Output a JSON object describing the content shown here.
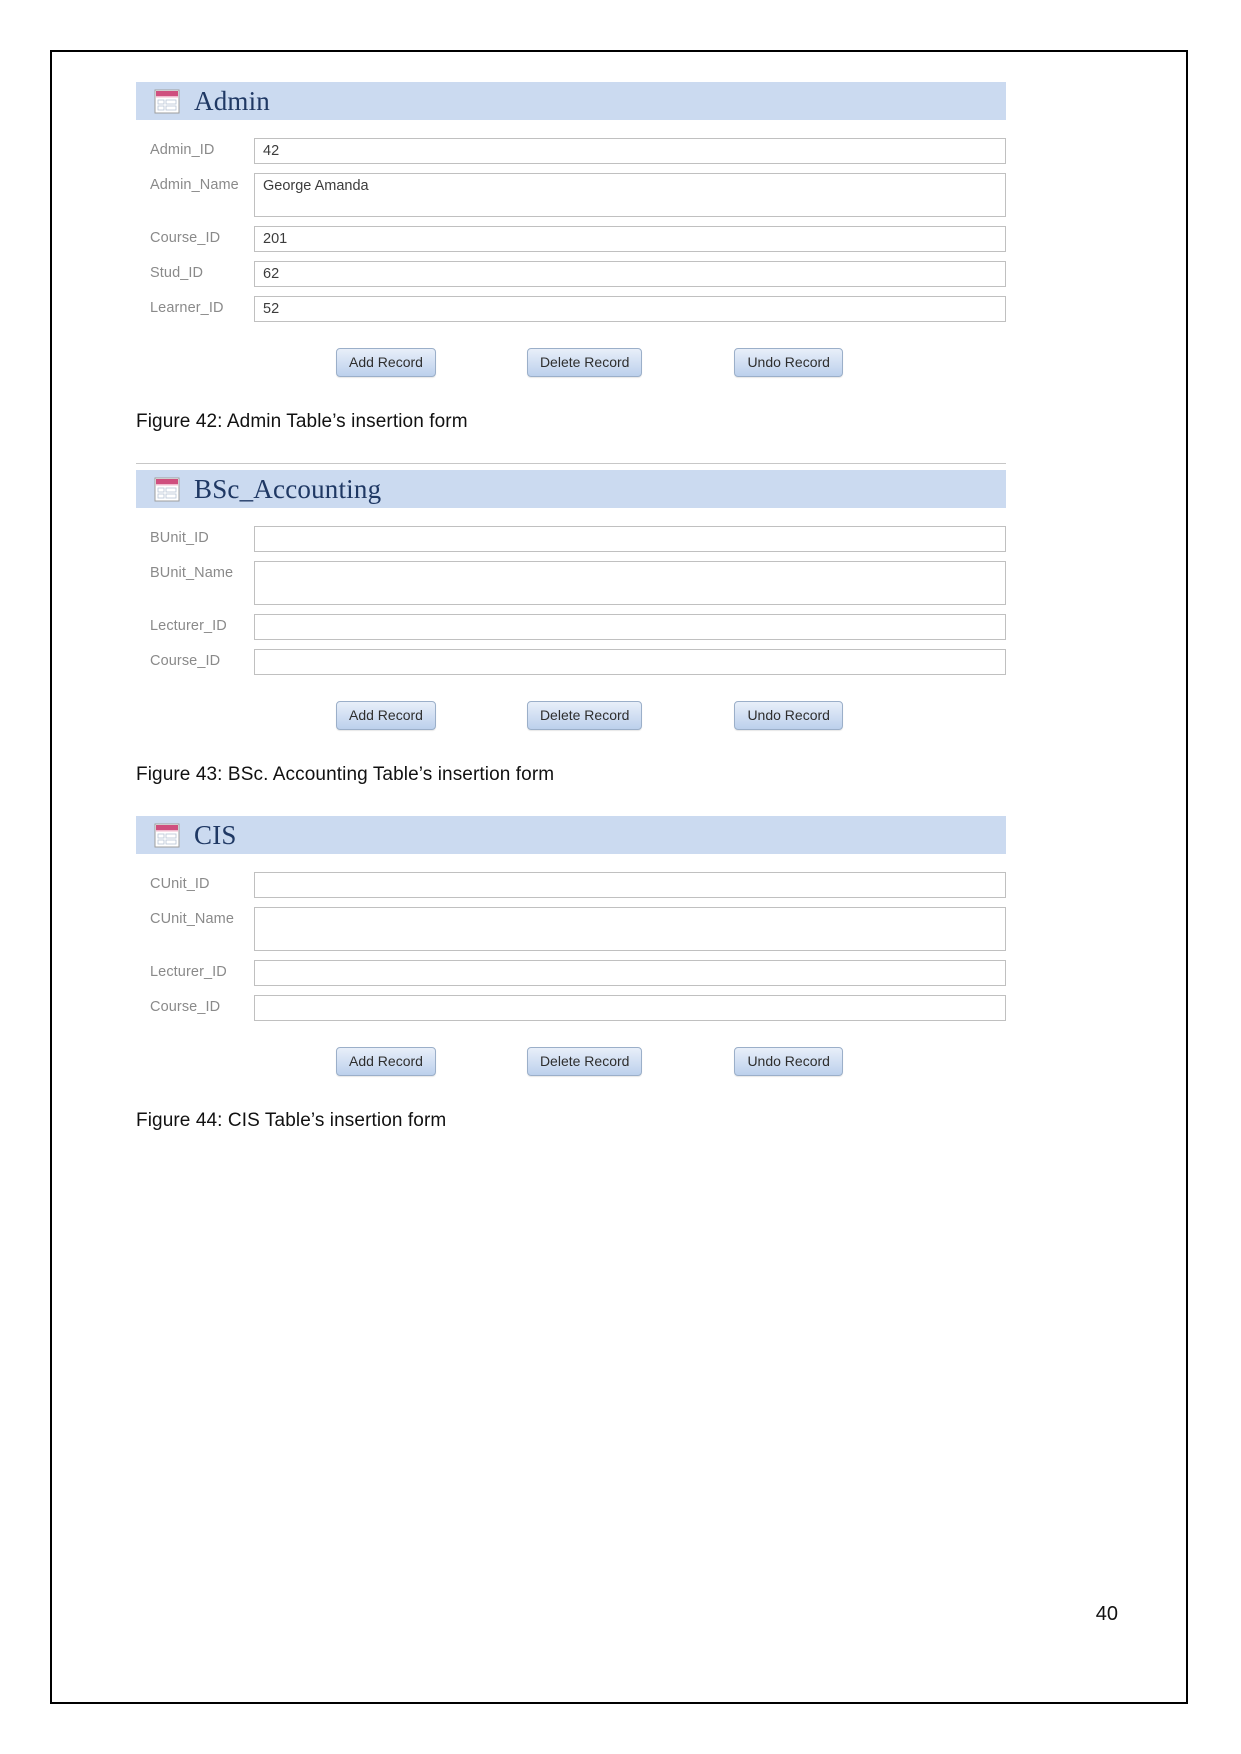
{
  "document": {
    "page_number": "40",
    "colors": {
      "header_bar": "#cbdaf0",
      "header_title_text": "#1f3864",
      "field_label_text": "#8a8a8a",
      "button_face": "#d3e0f3",
      "button_border": "#9bafc9",
      "field_border": "#c0c0c0",
      "icon_titlebar_pink": "#cf4f7e",
      "page_border": "#000000"
    }
  },
  "forms": [
    {
      "icon": "access-form-icon",
      "title": "Admin",
      "has_top_rule": false,
      "fields": [
        {
          "label": "Admin_ID",
          "value": "42",
          "tall": false
        },
        {
          "label": "Admin_Name",
          "value": "George Amanda",
          "tall": true
        },
        {
          "label": "Course_ID",
          "value": "201",
          "tall": false
        },
        {
          "label": "Stud_ID",
          "value": "62",
          "tall": false
        },
        {
          "label": "Learner_ID",
          "value": "52",
          "tall": false
        }
      ],
      "buttons": [
        {
          "label": "Add Record",
          "name": "add-record-button"
        },
        {
          "label": "Delete Record",
          "name": "delete-record-button"
        },
        {
          "label": "Undo Record",
          "name": "undo-record-button"
        }
      ],
      "caption": "Figure 42: Admin Table’s insertion form"
    },
    {
      "icon": "access-form-icon",
      "title": "BSc_Accounting",
      "has_top_rule": true,
      "fields": [
        {
          "label": "BUnit_ID",
          "value": "",
          "tall": false
        },
        {
          "label": "BUnit_Name",
          "value": "",
          "tall": true
        },
        {
          "label": "Lecturer_ID",
          "value": "",
          "tall": false
        },
        {
          "label": "Course_ID",
          "value": "",
          "tall": false
        }
      ],
      "buttons": [
        {
          "label": "Add Record",
          "name": "add-record-button"
        },
        {
          "label": "Delete Record",
          "name": "delete-record-button"
        },
        {
          "label": "Undo Record",
          "name": "undo-record-button"
        }
      ],
      "caption": "Figure 43: BSc. Accounting Table’s insertion form"
    },
    {
      "icon": "access-form-icon",
      "title": "CIS",
      "has_top_rule": false,
      "fields": [
        {
          "label": "CUnit_ID",
          "value": "",
          "tall": false
        },
        {
          "label": "CUnit_Name",
          "value": "",
          "tall": true
        },
        {
          "label": "Lecturer_ID",
          "value": "",
          "tall": false
        },
        {
          "label": "Course_ID",
          "value": "",
          "tall": false
        }
      ],
      "buttons": [
        {
          "label": "Add Record",
          "name": "add-record-button"
        },
        {
          "label": "Delete Record",
          "name": "delete-record-button"
        },
        {
          "label": "Undo Record",
          "name": "undo-record-button"
        }
      ],
      "caption": "Figure 44: CIS Table’s insertion form"
    }
  ]
}
